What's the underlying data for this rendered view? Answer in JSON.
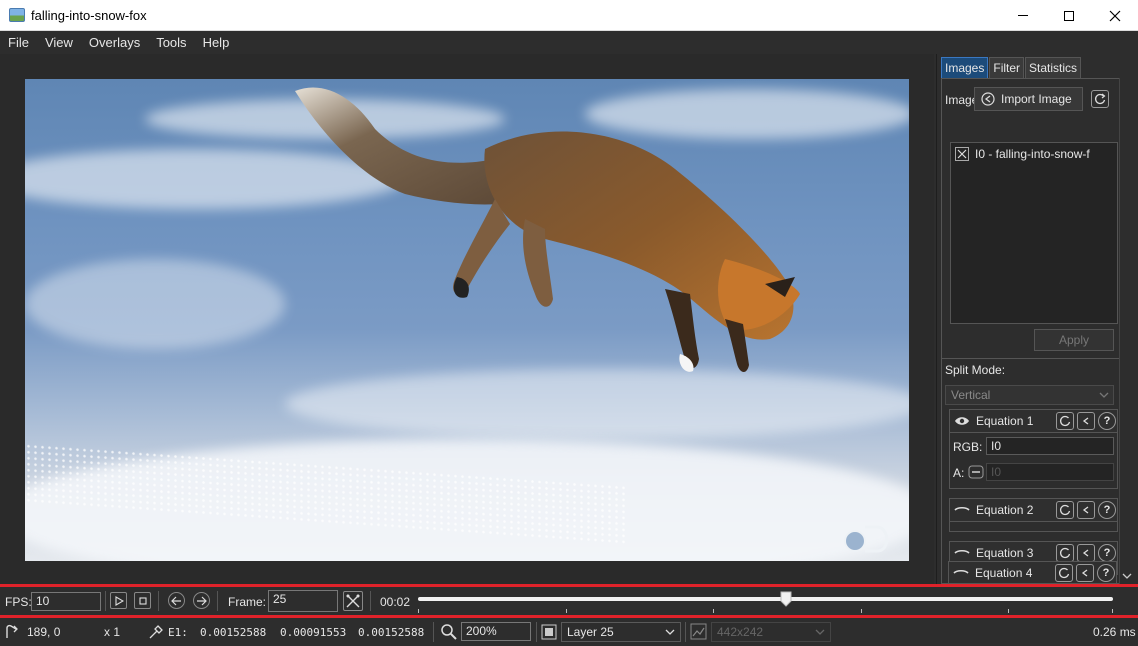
{
  "window": {
    "title": "falling-into-snow-fox",
    "minimize_icon": "minimize-icon",
    "maximize_icon": "maximize-icon",
    "close_icon": "close-icon"
  },
  "menu": [
    "File",
    "View",
    "Overlays",
    "Tools",
    "Help"
  ],
  "viewer": {
    "image_description": "fox-jumping-into-snow",
    "watermark_icon": "channel-logo-icon"
  },
  "sidepanel": {
    "tabs": [
      "Images",
      "Filter",
      "Statistics"
    ],
    "active_tab": "Images",
    "images_label": "Image",
    "import_button": "Import Image",
    "image_list": [
      {
        "label": "I0 - falling-into-snow-f"
      }
    ],
    "apply_button": "Apply",
    "split_mode_label": "Split Mode:",
    "split_mode_value": "Vertical",
    "equations": [
      {
        "name": "Equation 1",
        "expanded": true,
        "rgb_label": "RGB:",
        "rgb_value": "I0",
        "alpha_label": "A:",
        "alpha_placeholder": "I0"
      },
      {
        "name": "Equation 2",
        "expanded": false
      },
      {
        "name": "Equation 3",
        "expanded": false
      },
      {
        "name": "Equation 4",
        "expanded": false
      }
    ]
  },
  "playback": {
    "fps_label": "FPS:",
    "fps_value": "10",
    "frame_label": "Frame:",
    "frame_value": "25",
    "time": "00:02",
    "slider_position_fraction": 0.53
  },
  "status": {
    "cursor": "189, 0",
    "multiplier": "x 1",
    "error_label": "E1:",
    "error_values": [
      "0.00152588",
      "0.00091553",
      "0.00152588"
    ],
    "zoom": "200%",
    "layer": "Layer 25",
    "size": "442x242",
    "timing": "0.26 ms"
  }
}
